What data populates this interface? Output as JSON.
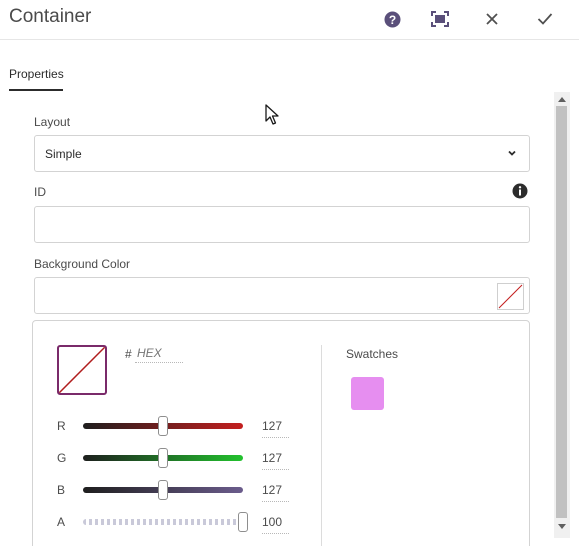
{
  "header": {
    "title": "Container",
    "buttons": [
      {
        "name": "help-icon",
        "color": "#5a4f7a"
      },
      {
        "name": "fullscreen-icon"
      },
      {
        "name": "close-icon"
      },
      {
        "name": "checkmark-icon"
      }
    ]
  },
  "tabs": {
    "active": "Properties"
  },
  "form": {
    "layout_label": "Layout",
    "layout_value": "Simple",
    "id_label": "ID",
    "id_value": "",
    "background_label": "Background Color",
    "background_value": ""
  },
  "color_picker": {
    "hash": "#",
    "hex_placeholder": "HEX",
    "swatches_label": "Swatches",
    "swatches": [
      "#e68ef0"
    ],
    "channels": [
      {
        "label": "R",
        "value": "127",
        "fraction": 0.5
      },
      {
        "label": "G",
        "value": "127",
        "fraction": 0.5
      },
      {
        "label": "B",
        "value": "127",
        "fraction": 0.5
      },
      {
        "label": "A",
        "value": "100",
        "fraction": 1.0
      }
    ]
  },
  "colors": {
    "accent": "#5a4f7a",
    "red_track": "#c41f1f",
    "green_track": "#22c22e",
    "blue_track": "#6b5c8c",
    "swatch": "#e68ef0"
  }
}
